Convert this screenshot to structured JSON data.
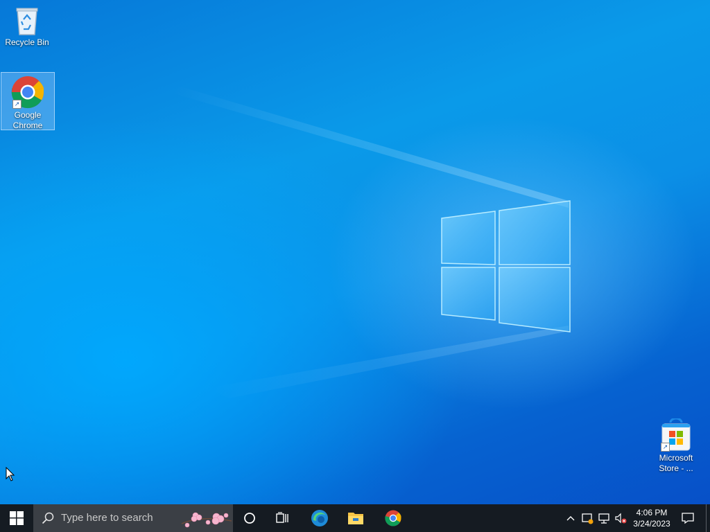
{
  "desktop": {
    "icons": [
      {
        "label": "Recycle Bin",
        "icon": "recycle-bin-icon"
      },
      {
        "label": "Google Chrome",
        "label_line1": "Google",
        "label_line2": "Chrome",
        "icon": "chrome-icon",
        "selected": true
      },
      {
        "label": "Microsoft Store - ...",
        "label_line1": "Microsoft",
        "label_line2": "Store - ...",
        "icon": "microsoft-store-icon"
      }
    ]
  },
  "taskbar": {
    "search_placeholder": "Type here to search",
    "pinned": [
      "cortana-icon",
      "task-view-icon",
      "edge-icon",
      "file-explorer-icon",
      "chrome-icon"
    ],
    "tray": {
      "time": "4:06 PM",
      "date": "3/24/2023"
    }
  },
  "colors": {
    "taskbar": "#151b22",
    "search": "#3b3f45",
    "wallpaper_accent": "#0a9ae9"
  }
}
